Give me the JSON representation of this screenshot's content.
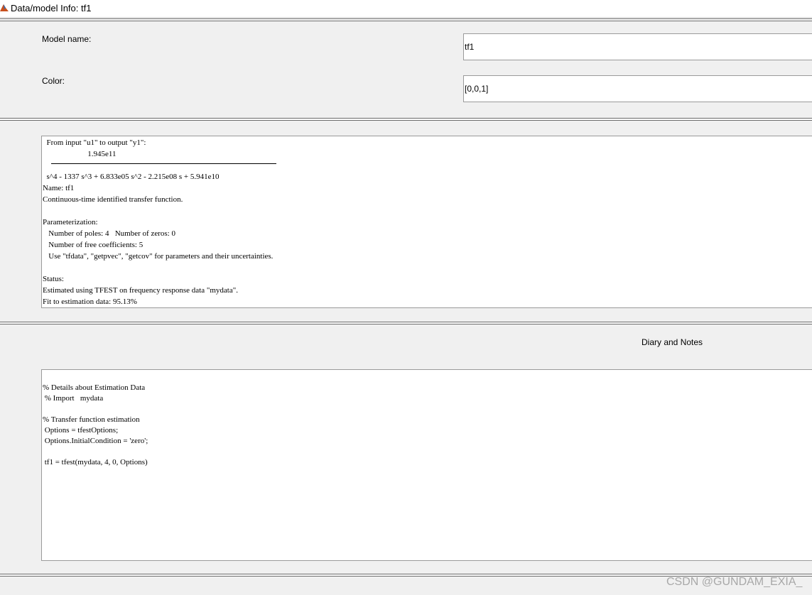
{
  "window": {
    "title": "Data/model Info: tf1",
    "icon": "matlab-icon"
  },
  "form": {
    "model_name_label": "Model name:",
    "model_name_value": "tf1",
    "color_label": "Color:",
    "color_value": "[0,0,1]"
  },
  "info": {
    "lines": [
      "  From input \"u1\" to output \"y1\":",
      "                       1.945e11",
      "",
      "  s^4 - 1337 s^3 + 6.833e05 s^2 - 2.215e08 s + 5.941e10",
      "Name: tf1",
      "Continuous-time identified transfer function.",
      "",
      "Parameterization:",
      "   Number of poles: 4   Number of zeros: 0",
      "   Number of free coefficients: 5",
      "   Use \"tfdata\", \"getpvec\", \"getcov\" for parameters and their uncertainties.",
      "",
      "Status:",
      "Estimated using TFEST on frequency response data \"mydata\".",
      "Fit to estimation data: 95.13%"
    ]
  },
  "diary": {
    "label": "Diary and Notes",
    "lines": [
      "",
      "% Details about Estimation Data",
      " % Import   mydata",
      "",
      "% Transfer function estimation",
      " Options = tfestOptions;",
      " Options.InitialCondition = 'zero';",
      "",
      " tf1 = tfest(mydata, 4, 0, Options)"
    ]
  },
  "watermark": "CSDN @GUNDAM_EXIA_"
}
